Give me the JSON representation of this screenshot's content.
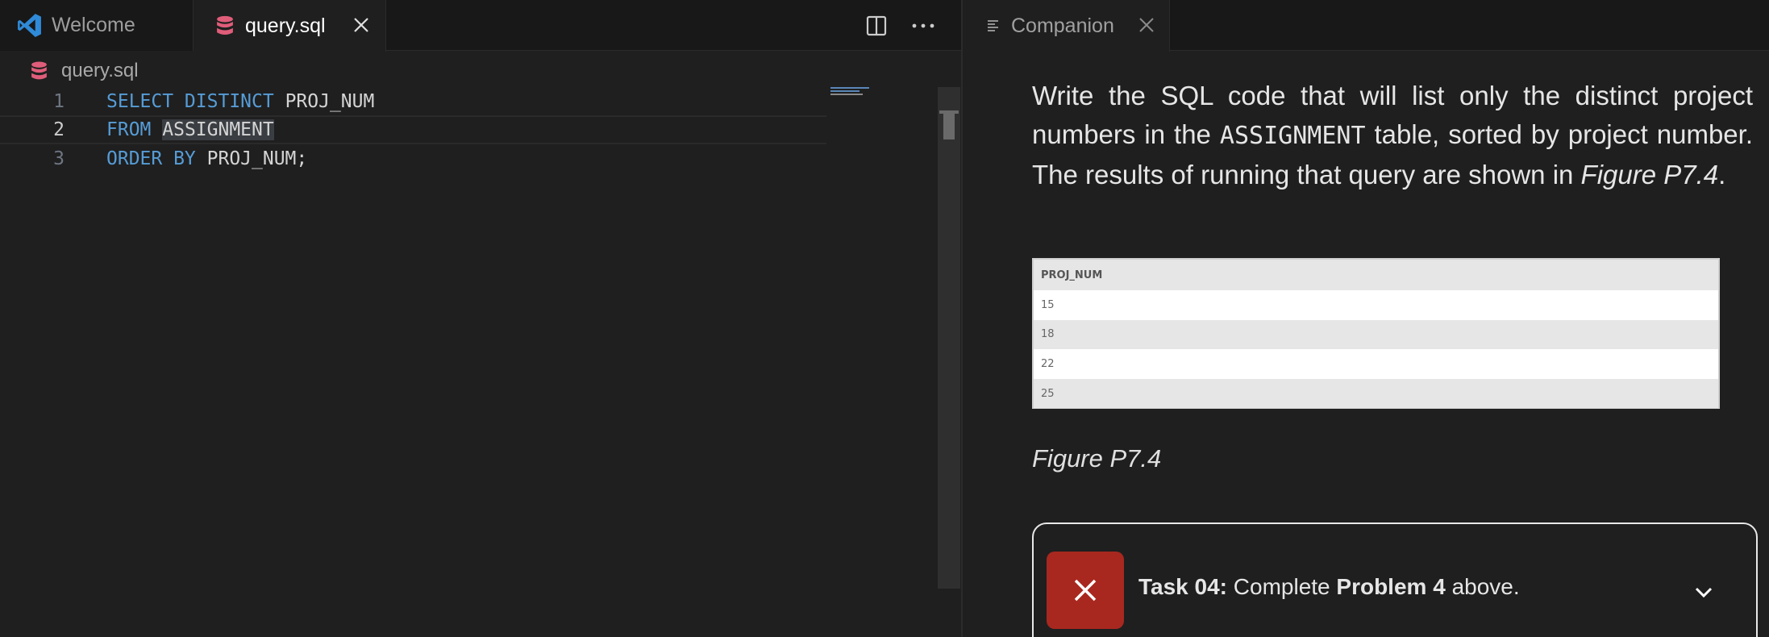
{
  "editor": {
    "tabs": [
      {
        "label": "Welcome",
        "icon": "vscode-logo-icon",
        "active": false
      },
      {
        "label": "query.sql",
        "icon": "database-icon",
        "active": true
      }
    ],
    "breadcrumb": {
      "file": "query.sql"
    },
    "lines": [
      {
        "num": "1",
        "kw1": "SELECT DISTINCT",
        "rest": " PROJ_NUM"
      },
      {
        "num": "2",
        "kw1": "FROM",
        "rest": "ASSIGNMENT"
      },
      {
        "num": "3",
        "kw1": "ORDER BY",
        "rest": " PROJ_NUM;"
      }
    ],
    "colors": {
      "keyword": "#569cd6",
      "db_icon": "#e05d7a",
      "vscode_blue": "#2f8ad8"
    }
  },
  "companion": {
    "tab_label": "Companion",
    "prose": {
      "part1": "Write the SQL code that will list only the distinct project numbers in the ",
      "table_name": "ASSIGNMENT",
      "part2": " table, sorted by project number. The results of running that query are shown in ",
      "figure_ref": "Figure P7.4",
      "part3": "."
    },
    "result_table": {
      "header": "PROJ_NUM",
      "rows": [
        "15",
        "18",
        "22",
        "25"
      ]
    },
    "figure_caption": "Figure P7.4",
    "task": {
      "prefix": "Task 04:",
      "text_before": " Complete ",
      "bold": "Problem 4",
      "text_after": " above.",
      "status_color": "#a8281f"
    }
  }
}
